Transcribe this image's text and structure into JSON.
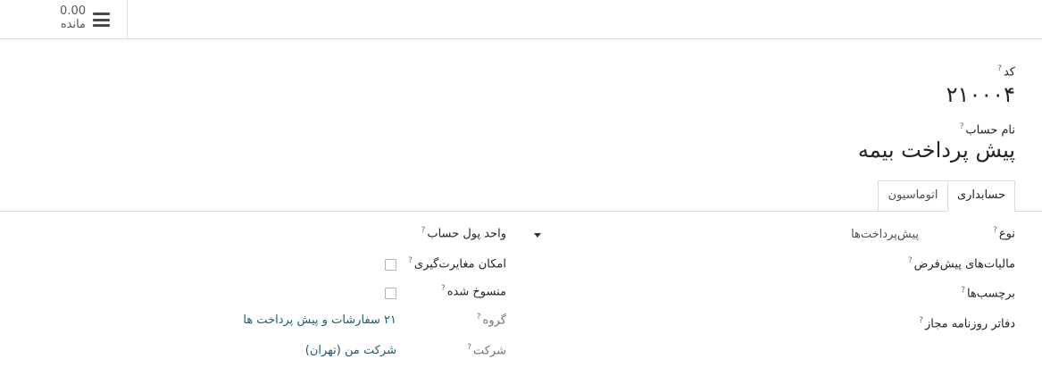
{
  "topbar": {
    "balance_value": "0.00",
    "balance_label": "مانده"
  },
  "header": {
    "code_label": "کد",
    "code_value": "۲۱۰۰۰۴",
    "name_label": "نام حساب",
    "name_value": "پیش پرداخت بیمه",
    "help_mark": "?"
  },
  "tabs": [
    {
      "label": "حسابداری",
      "active": true
    },
    {
      "label": "اتوماسیون",
      "active": false
    }
  ],
  "form_right": {
    "type_label": "نوع",
    "type_value": "پیش‌پرداخت‌ها",
    "default_taxes_label": "مالیات‌های پیش‌فرض",
    "tags_label": "برچسب‌ها",
    "allowed_journals_label": "دفاتر روزنامه مجاز"
  },
  "form_left": {
    "currency_label": "واحد پول حساب",
    "reconcile_label": "امکان مغایرت‌گیری",
    "reconcile_checked": false,
    "deprecated_label": "منسوخ شده",
    "deprecated_checked": false,
    "group_label": "گروه",
    "group_value": "۲۱ سفارشات و پیش پرداخت ها",
    "company_label": "شرکت",
    "company_value": "شرکت من (تهران)"
  },
  "colors": {
    "link": "#1b5e6e",
    "border": "#dcdcdc"
  },
  "icons": {
    "menu": "hamburger-icon",
    "dropdown": "caret-down-icon",
    "help": "question-mark"
  }
}
